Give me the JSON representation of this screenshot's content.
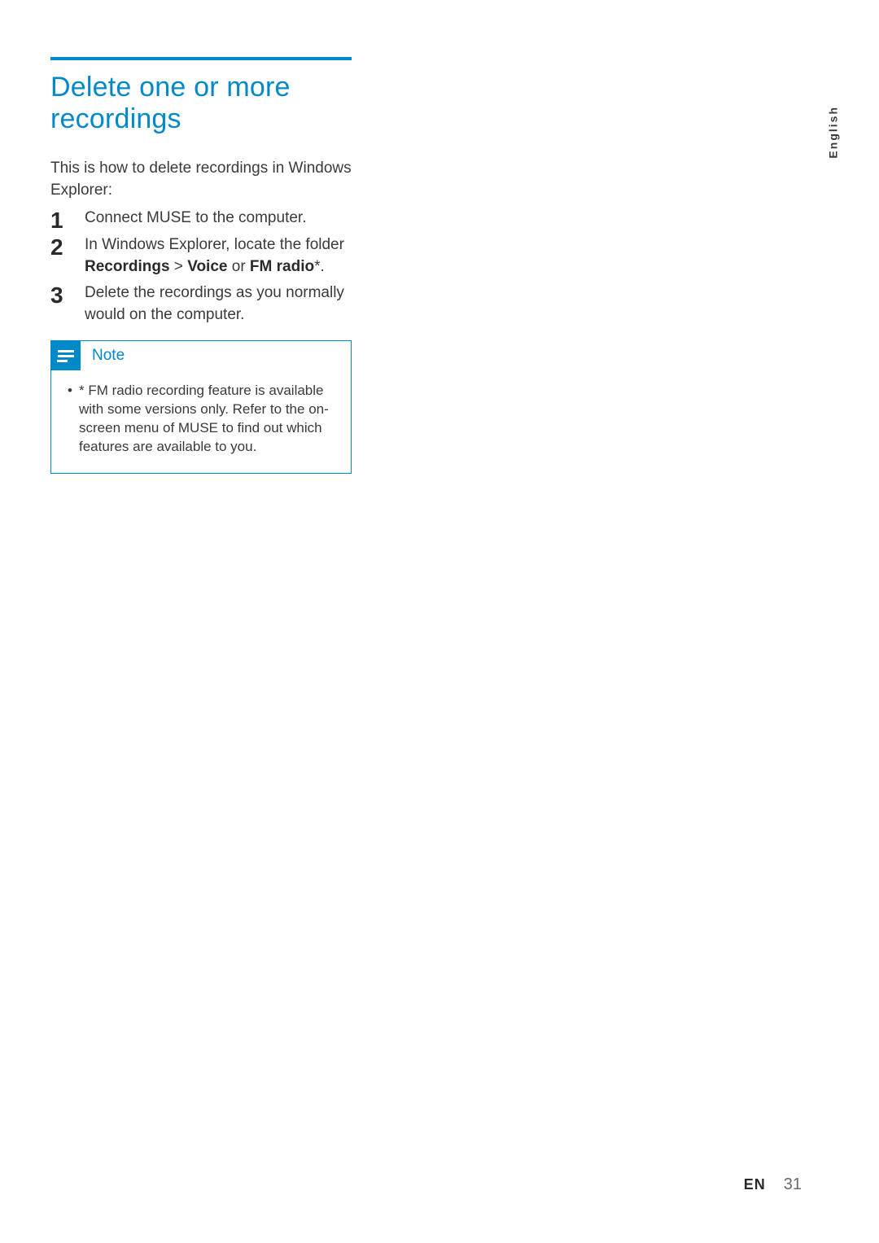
{
  "title": "Delete one or more recordings",
  "intro": "This is how to delete recordings in Windows Explorer:",
  "steps": {
    "s1": "Connect MUSE to the computer.",
    "s2_pre": "In Windows Explorer, locate the folder ",
    "s2_b1": "Recordings",
    "s2_gt": " > ",
    "s2_b2": "Voice",
    "s2_or": " or ",
    "s2_b3": "FM radio",
    "s2_post": "*.",
    "s3": "Delete the recordings as you normally would on the computer."
  },
  "note": {
    "label": "Note",
    "text": "* FM radio recording feature is available with some versions only. Refer to the on-screen menu of MUSE to find out which features are available to you."
  },
  "language_tag": "English",
  "footer": {
    "lang": "EN",
    "page": "31"
  }
}
